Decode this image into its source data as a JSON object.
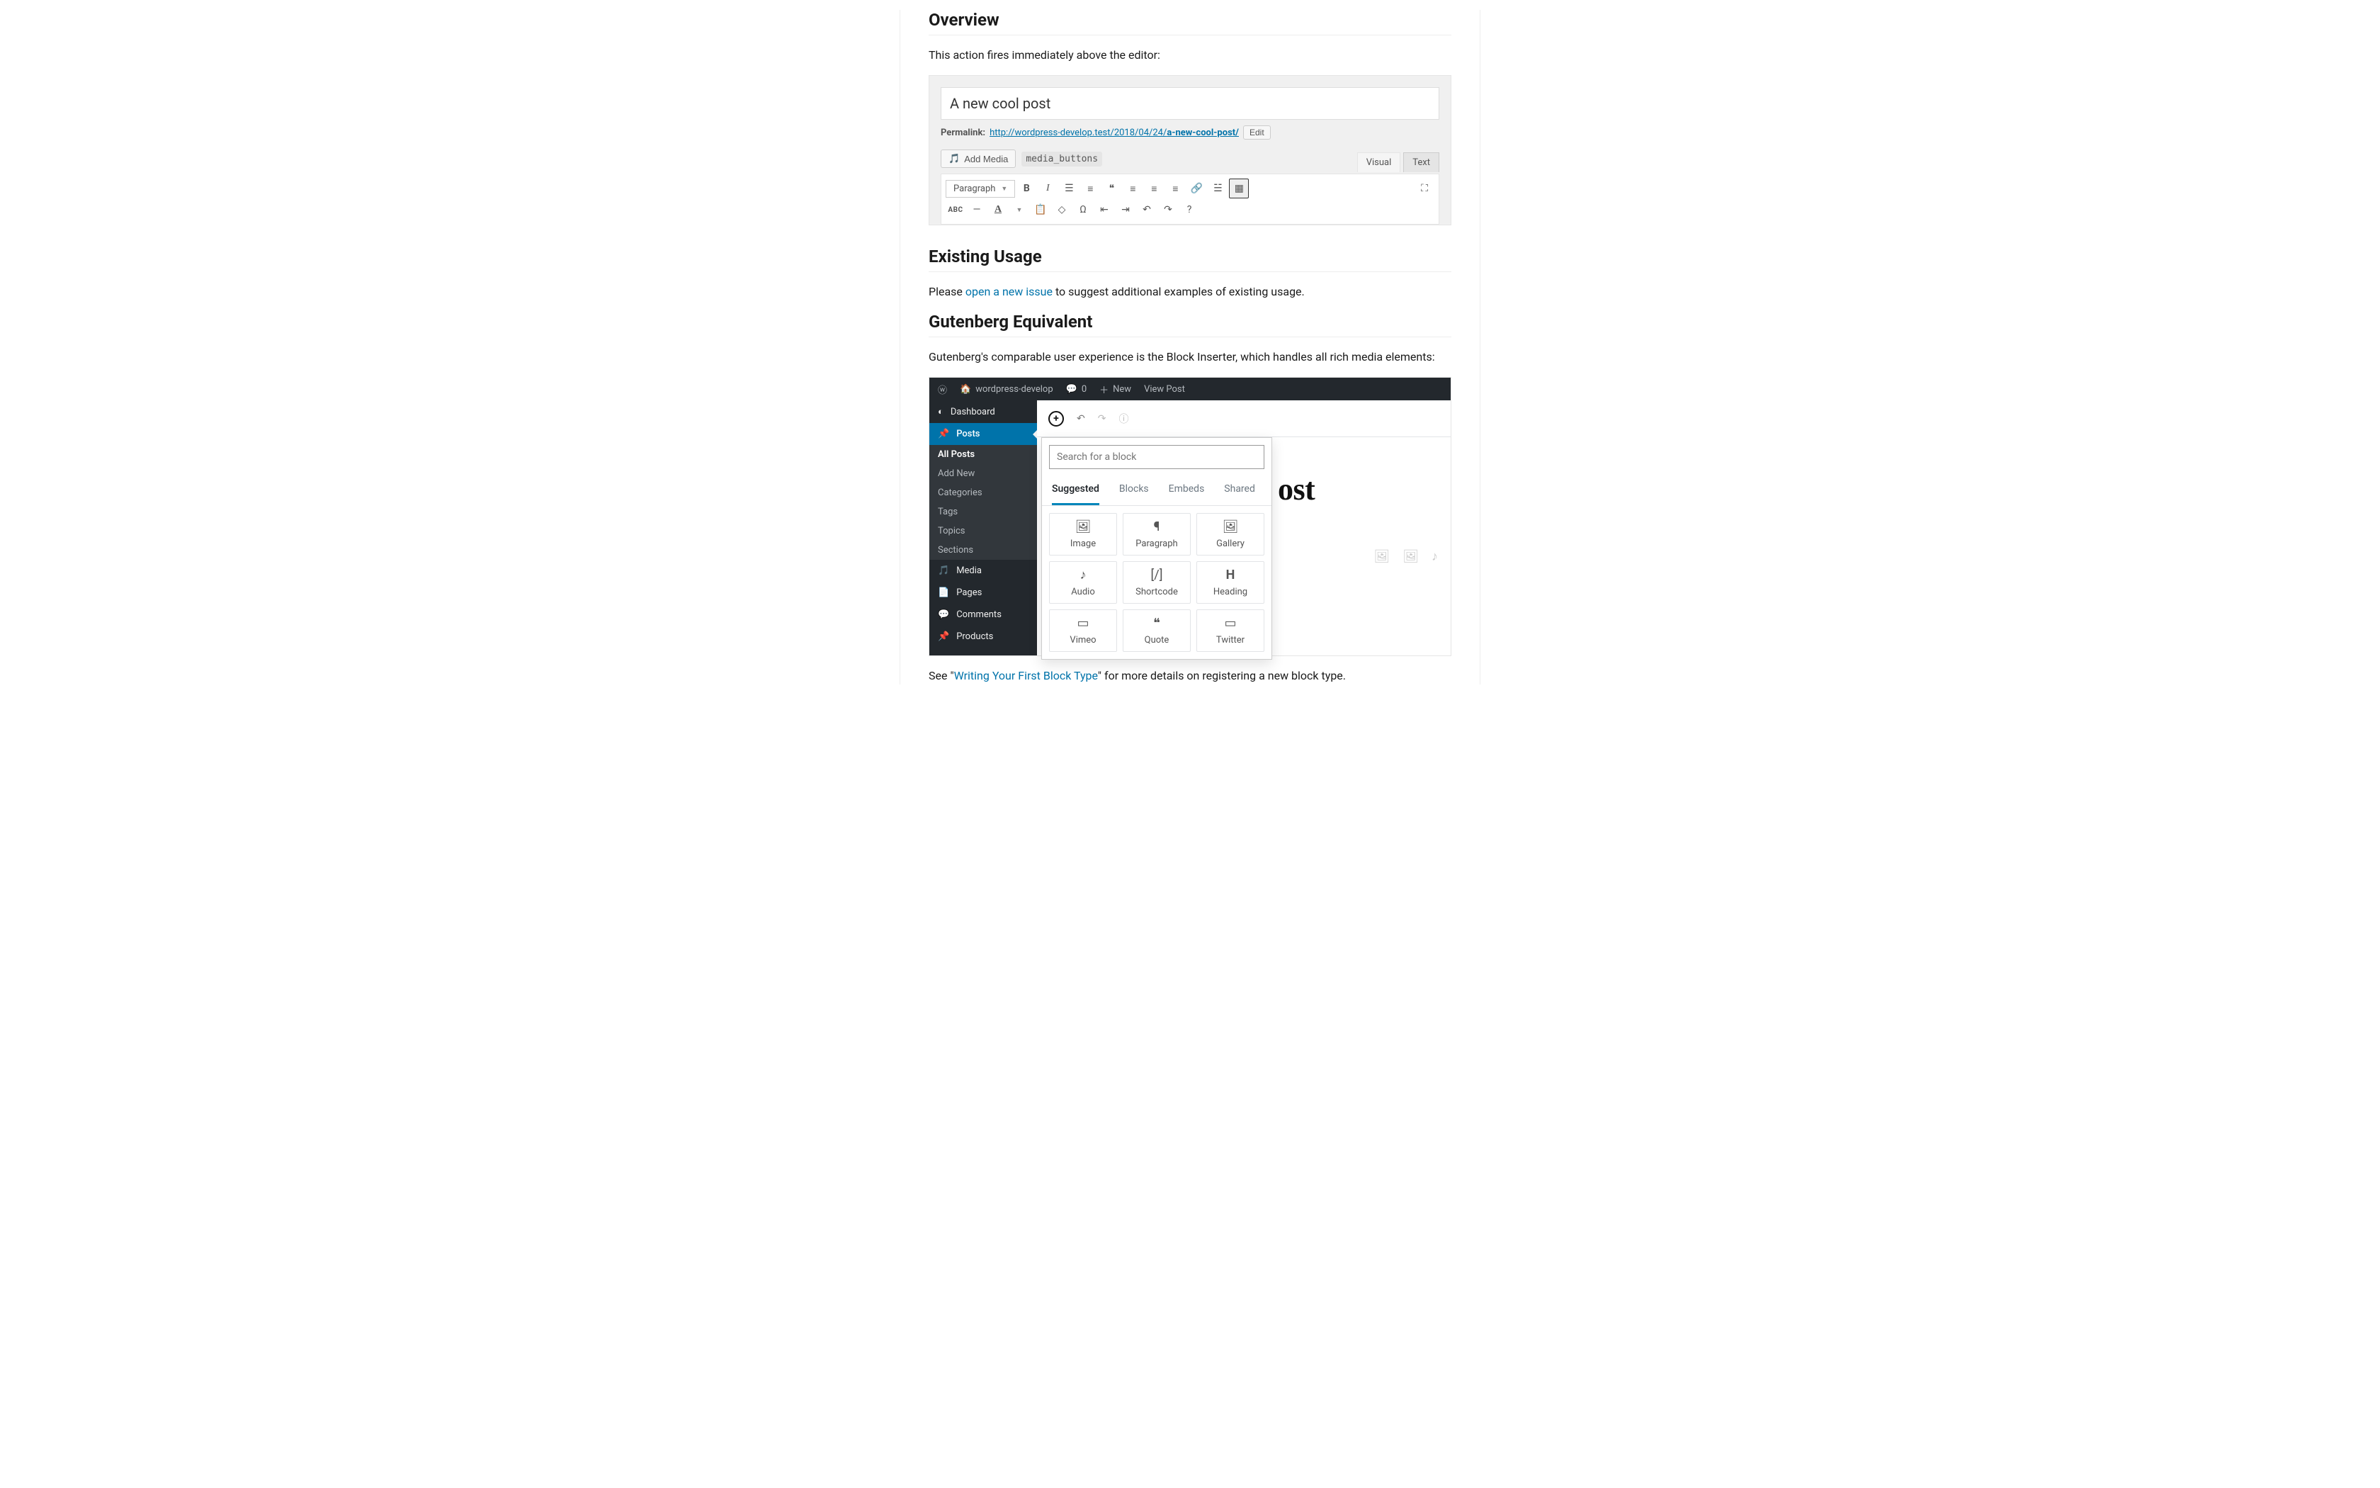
{
  "sections": {
    "overview_heading": "Overview",
    "overview_text": "This action fires immediately above the editor:",
    "existing_heading": "Existing Usage",
    "existing_prefix": "Please ",
    "existing_link": "open a new issue",
    "existing_suffix": " to suggest additional examples of existing usage.",
    "gutenberg_heading": "Gutenberg Equivalent",
    "gutenberg_text": "Gutenberg's comparable user experience is the Block Inserter, which handles all rich media elements:",
    "footnote_prefix": "See \"",
    "footnote_link": "Writing Your First Block Type",
    "footnote_suffix": "\" for more details on registering a new block type."
  },
  "classic": {
    "title_value": "A new cool post",
    "permalink_label": "Permalink:",
    "permalink_url_prefix": "http://wordpress-develop.test/2018/04/24/",
    "permalink_slug": "a-new-cool-post/",
    "edit_button": "Edit",
    "add_media_label": "Add Media",
    "hook_tag": "media_buttons",
    "tab_visual": "Visual",
    "tab_text": "Text",
    "paragraph_select": "Paragraph"
  },
  "gutenberg": {
    "admin_bar": {
      "site_name": "wordpress-develop",
      "comments_count": "0",
      "new_label": "New",
      "view_post": "View Post"
    },
    "sidebar": {
      "dashboard": "Dashboard",
      "posts": "Posts",
      "all_posts": "All Posts",
      "add_new": "Add New",
      "categories": "Categories",
      "tags": "Tags",
      "topics": "Topics",
      "sections": "Sections",
      "media": "Media",
      "pages": "Pages",
      "comments": "Comments",
      "products": "Products"
    },
    "inserter": {
      "search_placeholder": "Search for a block",
      "tab_suggested": "Suggested",
      "tab_blocks": "Blocks",
      "tab_embeds": "Embeds",
      "tab_shared": "Shared",
      "image": "Image",
      "paragraph": "Paragraph",
      "gallery": "Gallery",
      "audio": "Audio",
      "shortcode": "Shortcode",
      "heading": "Heading",
      "vimeo": "Vimeo",
      "quote": "Quote",
      "twitter": "Twitter"
    },
    "canvas_title_fragment": "ost"
  }
}
